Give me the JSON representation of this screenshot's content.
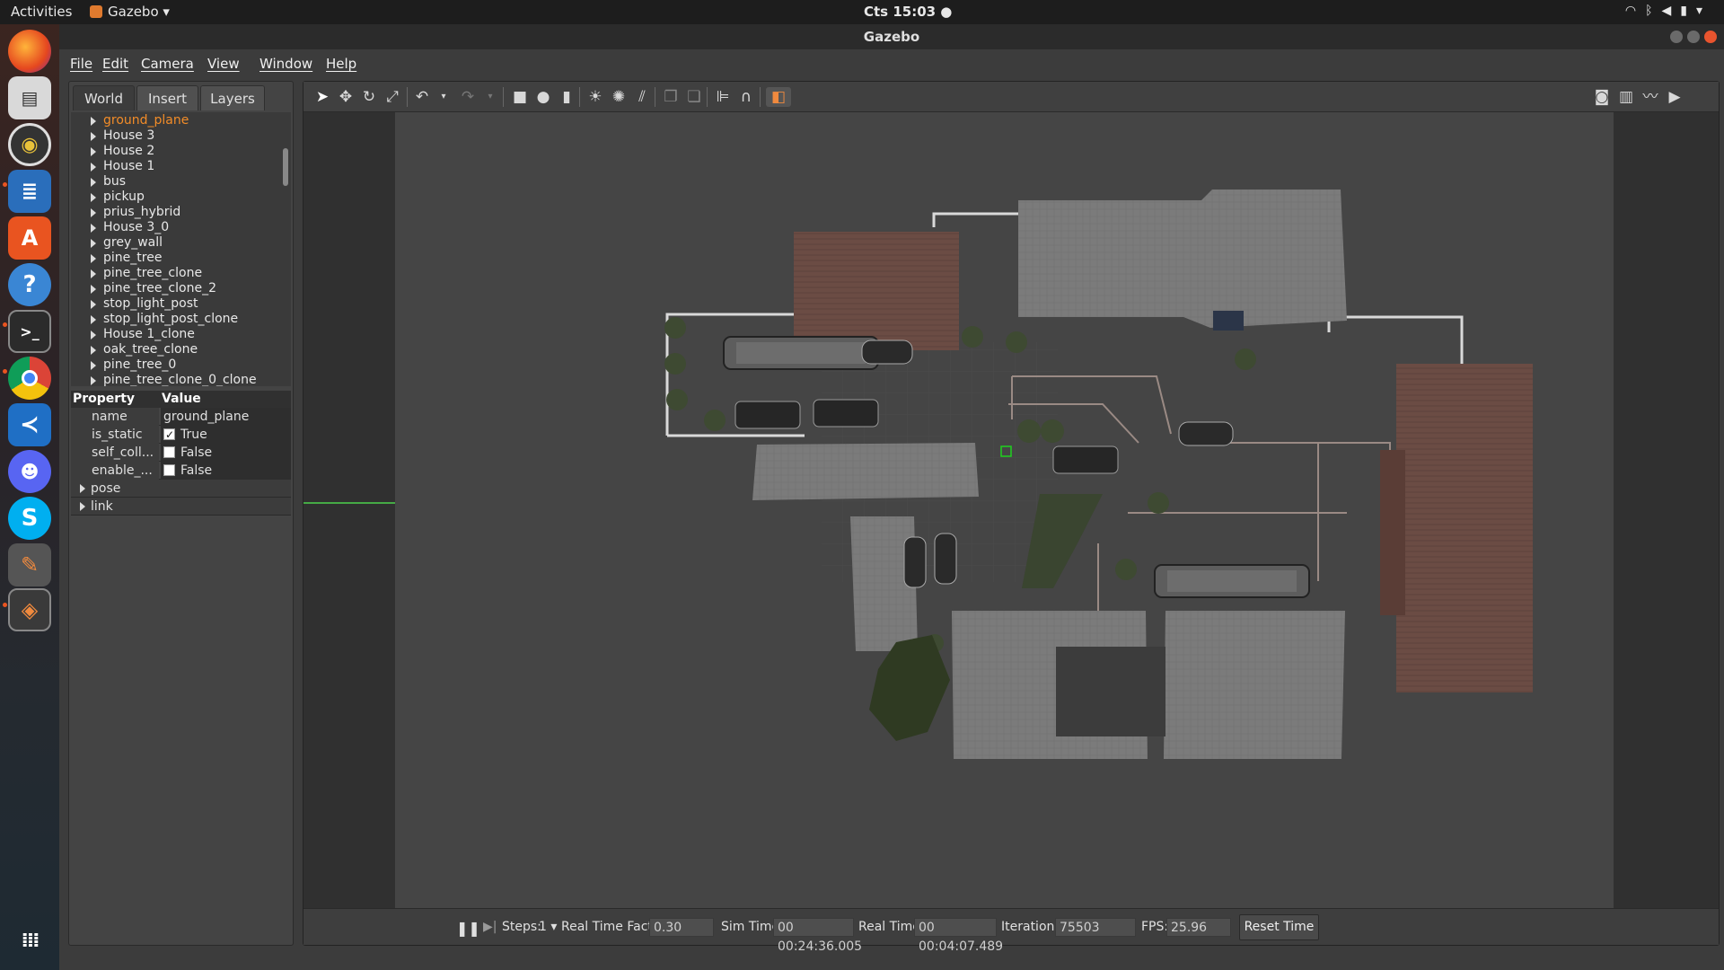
{
  "system": {
    "activities": "Activities",
    "app_name": "Gazebo ▾",
    "clock": "Cts 15:03 ●"
  },
  "window": {
    "title": "Gazebo"
  },
  "menu": [
    "File",
    "Edit",
    "Camera",
    "View",
    "Window",
    "Help"
  ],
  "left_panel": {
    "tabs": [
      "World",
      "Insert",
      "Layers"
    ],
    "active_tab": "World",
    "tree": [
      "ground_plane",
      "House 3",
      "House 2",
      "House 1",
      "bus",
      "pickup",
      "prius_hybrid",
      "House 3_0",
      "grey_wall",
      "pine_tree",
      "pine_tree_clone",
      "pine_tree_clone_2",
      "stop_light_post",
      "stop_light_post_clone",
      "House 1_clone",
      "oak_tree_clone",
      "pine_tree_0",
      "pine_tree_clone_0_clone"
    ],
    "selected": "ground_plane",
    "properties": {
      "header_property": "Property",
      "header_value": "Value",
      "rows": [
        {
          "key": "name",
          "value": "ground_plane"
        },
        {
          "key": "is_static",
          "value": "True",
          "checked": true
        },
        {
          "key": "self_coll...",
          "value": "False",
          "checked": false
        },
        {
          "key": "enable_...",
          "value": "False",
          "checked": false
        }
      ],
      "groups": [
        "pose",
        "link"
      ]
    }
  },
  "toolbar": {
    "icons": [
      "select-arrow-icon",
      "translate-icon",
      "rotate-icon",
      "scale-icon",
      "undo-icon",
      "redo-icon",
      "box-icon",
      "sphere-icon",
      "cylinder-icon",
      "point-light-icon",
      "spot-light-icon",
      "directional-light-icon",
      "copy-icon",
      "paste-icon",
      "align-icon",
      "snap-icon",
      "view-angle-icon",
      "screenshot-icon",
      "log-icon",
      "plot-icon",
      "record-icon"
    ]
  },
  "status": {
    "steps_label": "Steps:",
    "steps_value": "1 ▾",
    "rtf_label": "Real Time Factor:",
    "rtf_value": "0.30",
    "sim_time_label": "Sim Time:",
    "sim_time_value": "00 00:24:36.005",
    "real_time_label": "Real Time:",
    "real_time_value": "00 00:04:07.489",
    "iterations_label": "Iterations:",
    "iterations_value": "75503",
    "fps_label": "FPS:",
    "fps_value": "25.96",
    "reset_label": "Reset Time"
  },
  "colors": {
    "selection": "#f28c28",
    "accent": "#e9542e",
    "ground": "#454545",
    "roof_brown": "#6b4c44",
    "roof_grey": "#7a7a7a"
  }
}
